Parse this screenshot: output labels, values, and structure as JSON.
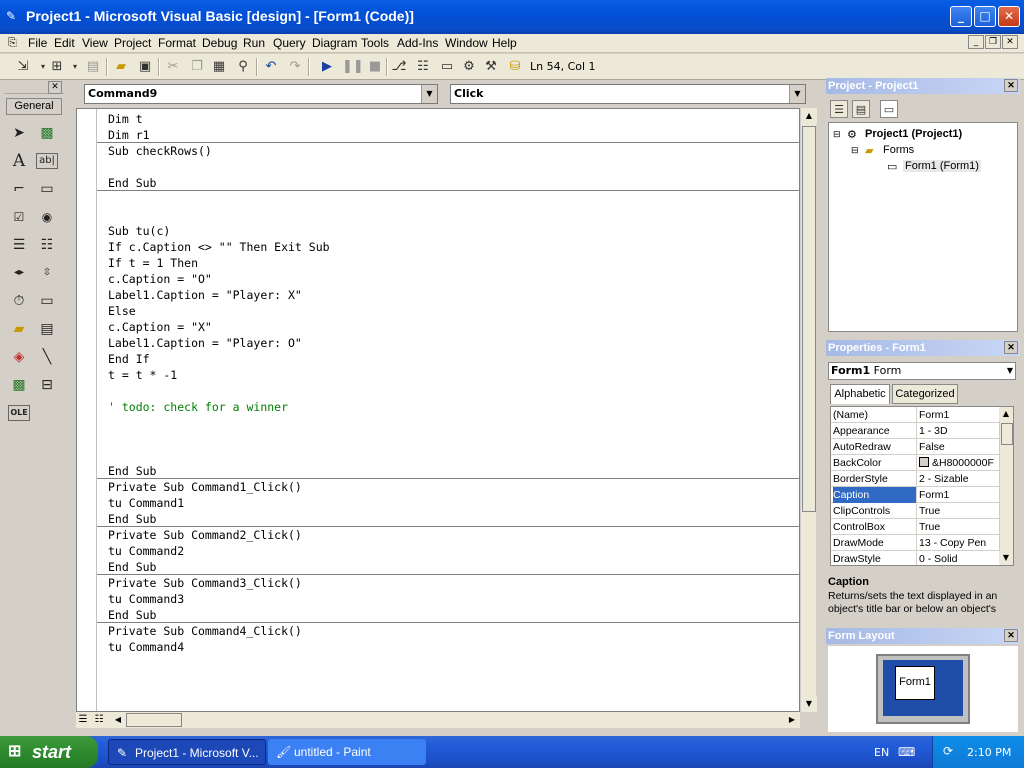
{
  "window": {
    "title": "Project1 - Microsoft Visual Basic [design] - [Form1 (Code)]",
    "minimize": "_",
    "maximize": "□",
    "close": "✕"
  },
  "menu": [
    "File",
    "Edit",
    "View",
    "Project",
    "Format",
    "Debug",
    "Run",
    "Query",
    "Diagram",
    "Tools",
    "Add-Ins",
    "Window",
    "Help"
  ],
  "toolbar": {
    "status": "Ln 54, Col 1"
  },
  "toolbox": {
    "tab_label": "General",
    "close": "✕"
  },
  "code": {
    "object_combo": "Command9",
    "procedure_combo": "Click",
    "lines": [
      {
        "text": "Dim t",
        "type": "code"
      },
      {
        "text": "Dim r1",
        "type": "code"
      },
      {
        "text": "",
        "type": "sep"
      },
      {
        "text": "Sub checkRows()",
        "type": "code"
      },
      {
        "text": "",
        "type": "blank"
      },
      {
        "text": "End Sub",
        "type": "code"
      },
      {
        "text": "",
        "type": "sep"
      },
      {
        "text": "",
        "type": "blank"
      },
      {
        "text": "",
        "type": "blank"
      },
      {
        "text": "Sub tu(c)",
        "type": "code"
      },
      {
        "text": "If c.Caption <> \"\" Then Exit Sub",
        "type": "code"
      },
      {
        "text": "If t = 1 Then",
        "type": "code"
      },
      {
        "text": "c.Caption = \"O\"",
        "type": "code"
      },
      {
        "text": "Label1.Caption = \"Player: X\"",
        "type": "code"
      },
      {
        "text": "Else",
        "type": "code"
      },
      {
        "text": "c.Caption = \"X\"",
        "type": "code"
      },
      {
        "text": "Label1.Caption = \"Player: O\"",
        "type": "code"
      },
      {
        "text": "End If",
        "type": "code"
      },
      {
        "text": "t = t * -1",
        "type": "code"
      },
      {
        "text": "",
        "type": "blank"
      },
      {
        "text": "' todo: check for a winner",
        "type": "comment"
      },
      {
        "text": "",
        "type": "blank"
      },
      {
        "text": "",
        "type": "blank"
      },
      {
        "text": "",
        "type": "blank"
      },
      {
        "text": "End Sub",
        "type": "code"
      },
      {
        "text": "",
        "type": "sep"
      },
      {
        "text": "Private Sub Command1_Click()",
        "type": "code"
      },
      {
        "text": "tu Command1",
        "type": "code"
      },
      {
        "text": "End Sub",
        "type": "code"
      },
      {
        "text": "",
        "type": "sep"
      },
      {
        "text": "Private Sub Command2_Click()",
        "type": "code"
      },
      {
        "text": "tu Command2",
        "type": "code"
      },
      {
        "text": "End Sub",
        "type": "code"
      },
      {
        "text": "",
        "type": "sep"
      },
      {
        "text": "Private Sub Command3_Click()",
        "type": "code"
      },
      {
        "text": "tu Command3",
        "type": "code"
      },
      {
        "text": "End Sub",
        "type": "code"
      },
      {
        "text": "",
        "type": "sep"
      },
      {
        "text": "Private Sub Command4_Click()",
        "type": "code"
      },
      {
        "text": "tu Command4",
        "type": "code"
      }
    ]
  },
  "project": {
    "title": "Project - Project1",
    "root": "Project1 (Project1)",
    "folder": "Forms",
    "form": "Form1 (Form1)"
  },
  "properties": {
    "title": "Properties - Form1",
    "object_name": "Form1",
    "object_type": "Form",
    "tabs": [
      "Alphabetic",
      "Categorized"
    ],
    "rows": [
      {
        "name": "(Name)",
        "value": "Form1"
      },
      {
        "name": "Appearance",
        "value": "1 - 3D"
      },
      {
        "name": "AutoRedraw",
        "value": "False"
      },
      {
        "name": "BackColor",
        "value": "&H8000000F"
      },
      {
        "name": "BorderStyle",
        "value": "2 - Sizable"
      },
      {
        "name": "Caption",
        "value": "Form1"
      },
      {
        "name": "ClipControls",
        "value": "True"
      },
      {
        "name": "ControlBox",
        "value": "True"
      },
      {
        "name": "DrawMode",
        "value": "13 - Copy Pen"
      },
      {
        "name": "DrawStyle",
        "value": "0 - Solid"
      }
    ],
    "selected_index": 5,
    "desc_title": "Caption",
    "desc_text": "Returns/sets the text displayed in an object's title bar or below an object's"
  },
  "form_layout": {
    "title": "Form Layout",
    "form_label": "Form1"
  },
  "taskbar": {
    "start": "start",
    "items": [
      "Project1 - Microsoft V...",
      "untitled - Paint"
    ],
    "lang": "EN",
    "time": "2:10 PM"
  },
  "colors": {
    "title_blue": "#0a5fe4",
    "comment_green": "#007f00",
    "selection_blue": "#316ac5",
    "panel_header": "#a6b9e6"
  }
}
